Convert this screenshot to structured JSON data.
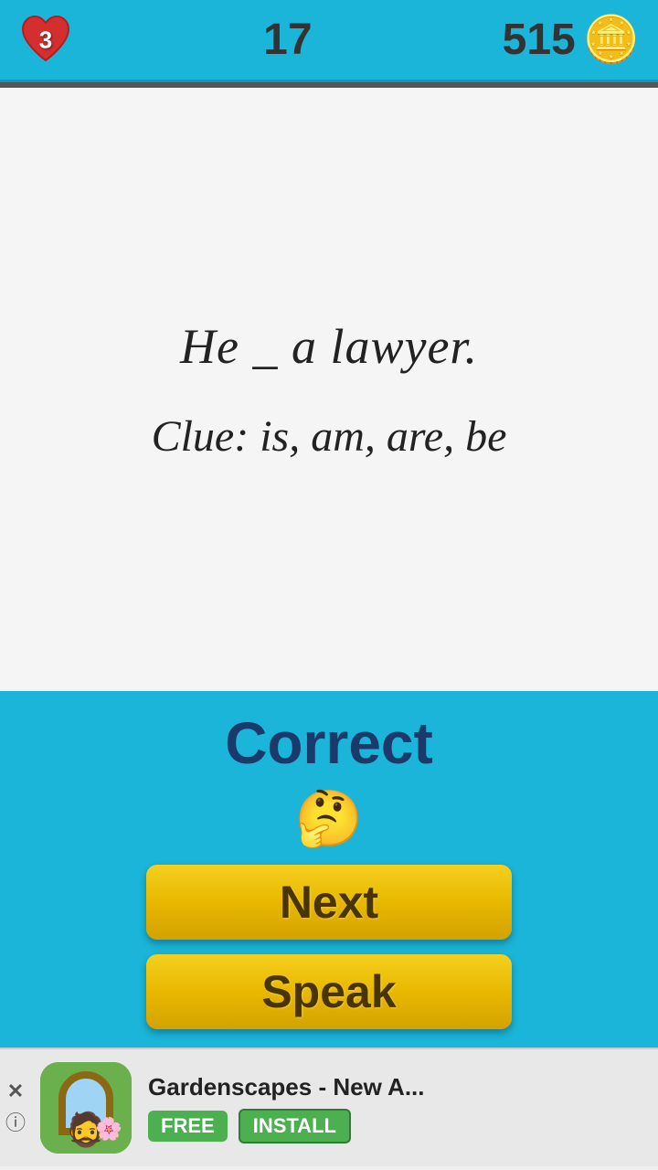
{
  "header": {
    "lives": "3",
    "level": "17",
    "coins": "515"
  },
  "question": {
    "sentence": "He _ a lawyer.",
    "clue": "Clue: is, am, are, be"
  },
  "result": {
    "status": "Correct",
    "emoji": "🤔",
    "next_button": "Next",
    "speak_button": "Speak"
  },
  "ad": {
    "title": "Gardenscapes - New A...",
    "free_label": "FREE",
    "install_label": "INSTALL",
    "close_label": "✕",
    "info_label": "ⓘ"
  }
}
